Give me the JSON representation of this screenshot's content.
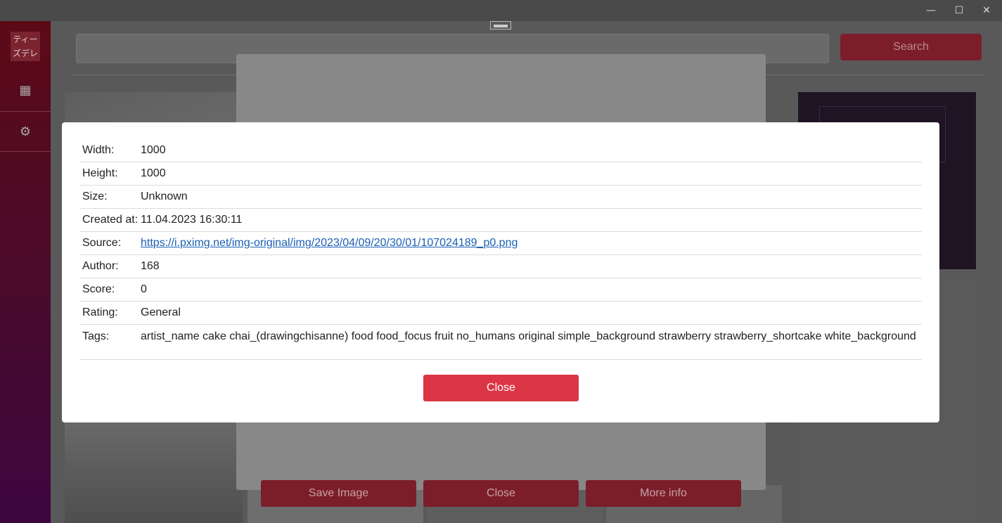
{
  "window": {
    "minimize_glyph": "—",
    "maximize_glyph": "☐",
    "close_glyph": "✕"
  },
  "sidebar": {
    "logo_text": "ティーズデレ",
    "items": [
      {
        "icon": "grid-icon",
        "glyph": "▦"
      },
      {
        "icon": "gear-icon",
        "glyph": "⚙"
      }
    ]
  },
  "search": {
    "value": "",
    "placeholder": "",
    "button_label": "Search"
  },
  "viewer": {
    "save_label": "Save Image",
    "close_label": "Close",
    "more_info_label": "More info"
  },
  "info": {
    "rows": [
      {
        "label": "Width:",
        "value": "1000"
      },
      {
        "label": "Height:",
        "value": "1000"
      },
      {
        "label": "Size:",
        "value": "Unknown"
      },
      {
        "label": "Created at:",
        "value": "11.04.2023 16:30:11"
      },
      {
        "label": "Source:",
        "value": "https://i.pximg.net/img-original/img/2023/04/09/20/30/01/107024189_p0.png"
      },
      {
        "label": "Author:",
        "value": "168"
      },
      {
        "label": "Score:",
        "value": "0"
      },
      {
        "label": "Rating:",
        "value": "General"
      },
      {
        "label": "Tags:",
        "value": "artist_name cake chai_(drawingchisanne) food food_focus fruit no_humans original simple_background strawberry strawberry_shortcake white_background"
      }
    ],
    "close_label": "Close"
  },
  "colors": {
    "accent": "#dc3545",
    "link": "#1a5fb4"
  }
}
